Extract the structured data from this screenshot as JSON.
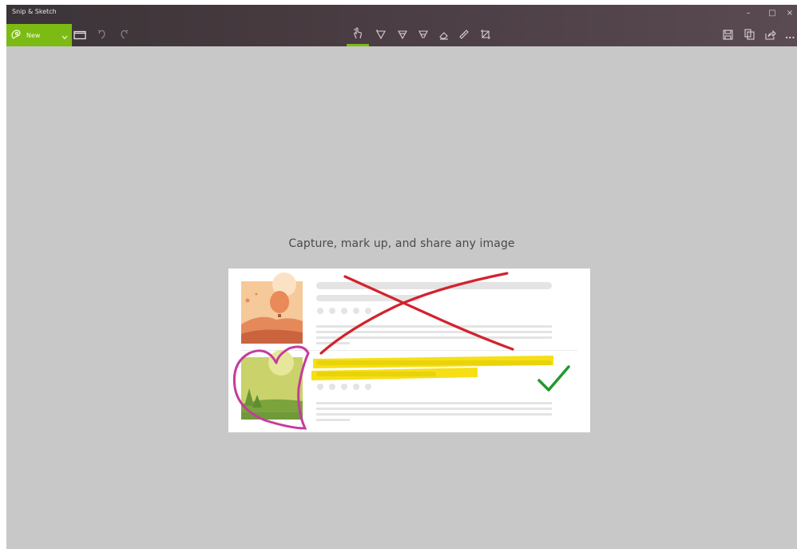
{
  "window": {
    "title": "Snip & Sketch",
    "controls": {
      "minimize": "–",
      "maximize": "□",
      "close": "×"
    }
  },
  "toolbar": {
    "new_label": "New",
    "left_icons": [
      "new-snip-icon",
      "chevron-down-icon",
      "open-folder-icon",
      "undo-icon",
      "redo-icon"
    ],
    "center_tools": [
      "touch-writing-icon",
      "ballpoint-pen-icon",
      "pencil-icon",
      "highlighter-icon",
      "eraser-icon",
      "ruler-icon",
      "crop-icon"
    ],
    "right_icons": [
      "save-icon",
      "copy-icon",
      "share-icon",
      "more-icon"
    ],
    "more_label": "..."
  },
  "main": {
    "caption": "Capture, mark up, and share any image"
  },
  "colors": {
    "accent": "#7cbb14",
    "canvas": "#c8c8c8",
    "titlebar": "#45393e",
    "markup_red": "#d2232e",
    "markup_pink": "#c53c9b",
    "markup_yellow": "#f5dc00",
    "markup_green": "#1f9a2c"
  }
}
